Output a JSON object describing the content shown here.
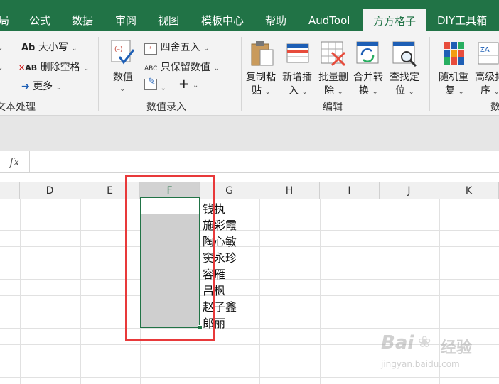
{
  "tabs": [
    "局",
    "公式",
    "数据",
    "审阅",
    "视图",
    "模板中心",
    "帮助",
    "AudTool",
    "方方格子",
    "DIY工具箱"
  ],
  "active_tab": "方方格子",
  "ribbon": {
    "text_group": {
      "case_btn": "大小写",
      "case_icon_text": "Ab",
      "remove_space_btn": "删除空格",
      "remove_space_icon_text": "AB",
      "more_btn": "更多",
      "group_label": "文本处理"
    },
    "num_group": {
      "value_btn": "数值",
      "round_btn": "四舍五入",
      "keep_num_btn": "只保留数值",
      "keep_num_icon_text": "ABC",
      "plus": "+",
      "group_label": "数值录入"
    },
    "edit_group": {
      "copy_paste_l1": "复制粘",
      "copy_paste_l2": "贴",
      "add_insert_l1": "新增插",
      "add_insert_l2": "入",
      "batch_delete_l1": "批量删",
      "batch_delete_l2": "除",
      "merge_l1": "合并转",
      "merge_l2": "换",
      "find_l1": "查找定",
      "find_l2": "位",
      "group_label": "编辑"
    },
    "data_group": {
      "random_l1": "随机重",
      "random_l2": "复",
      "sort_l1": "高级排",
      "sort_l2": "序",
      "sort_icon_text": "ZA",
      "group_label": "数"
    }
  },
  "formula_bar": {
    "fx": "fx",
    "value": ""
  },
  "columns": [
    "D",
    "E",
    "F",
    "G",
    "H",
    "I",
    "J",
    "K"
  ],
  "selected_column": "F",
  "names": [
    "钱执",
    "施彩霞",
    "陶心敏",
    "窦永珍",
    "容雁",
    "吕枫",
    "赵子鑫",
    "郎丽"
  ],
  "watermark": {
    "line1": "Bai",
    "line2": "经验",
    "url": "jingyan.baidu.com"
  }
}
